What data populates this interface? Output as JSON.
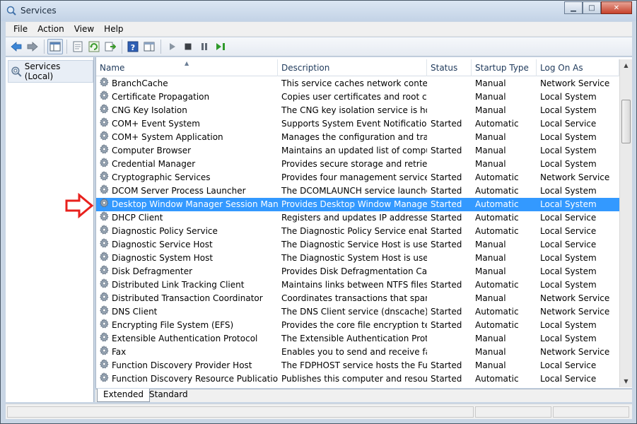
{
  "window": {
    "title": "Services",
    "minimize": "▁",
    "maximize": "□",
    "close": "✕"
  },
  "menu": {
    "file": "File",
    "action": "Action",
    "view": "View",
    "help": "Help"
  },
  "tree": {
    "root_label": "Services (Local)"
  },
  "columns": {
    "name": "Name",
    "description": "Description",
    "status": "Status",
    "startup": "Startup Type",
    "logon": "Log On As"
  },
  "services": [
    {
      "name": "BranchCache",
      "description": "This service caches network content...",
      "status": "",
      "startup": "Manual",
      "logon": "Network Service"
    },
    {
      "name": "Certificate Propagation",
      "description": "Copies user certificates and root cer...",
      "status": "",
      "startup": "Manual",
      "logon": "Local System"
    },
    {
      "name": "CNG Key Isolation",
      "description": "The CNG key isolation service is hos...",
      "status": "",
      "startup": "Manual",
      "logon": "Local System"
    },
    {
      "name": "COM+ Event System",
      "description": "Supports System Event Notification ...",
      "status": "Started",
      "startup": "Automatic",
      "logon": "Local Service"
    },
    {
      "name": "COM+ System Application",
      "description": "Manages the configuration and trac...",
      "status": "",
      "startup": "Manual",
      "logon": "Local System"
    },
    {
      "name": "Computer Browser",
      "description": "Maintains an updated list of compu...",
      "status": "Started",
      "startup": "Manual",
      "logon": "Local System"
    },
    {
      "name": "Credential Manager",
      "description": "Provides secure storage and retrieva...",
      "status": "",
      "startup": "Manual",
      "logon": "Local System"
    },
    {
      "name": "Cryptographic Services",
      "description": "Provides four management services:...",
      "status": "Started",
      "startup": "Automatic",
      "logon": "Network Service"
    },
    {
      "name": "DCOM Server Process Launcher",
      "description": "The DCOMLAUNCH service launche...",
      "status": "Started",
      "startup": "Automatic",
      "logon": "Local System"
    },
    {
      "name": "Desktop Window Manager Session Manager",
      "description": "Provides Desktop Window Manager ...",
      "status": "Started",
      "startup": "Automatic",
      "logon": "Local System"
    },
    {
      "name": "DHCP Client",
      "description": "Registers and updates IP addresses a...",
      "status": "Started",
      "startup": "Automatic",
      "logon": "Local Service"
    },
    {
      "name": "Diagnostic Policy Service",
      "description": "The Diagnostic Policy Service enabl...",
      "status": "Started",
      "startup": "Automatic",
      "logon": "Local Service"
    },
    {
      "name": "Diagnostic Service Host",
      "description": "The Diagnostic Service Host is used ...",
      "status": "Started",
      "startup": "Manual",
      "logon": "Local Service"
    },
    {
      "name": "Diagnostic System Host",
      "description": "The Diagnostic System Host is used ...",
      "status": "",
      "startup": "Manual",
      "logon": "Local System"
    },
    {
      "name": "Disk Defragmenter",
      "description": "Provides Disk Defragmentation Cap...",
      "status": "",
      "startup": "Manual",
      "logon": "Local System"
    },
    {
      "name": "Distributed Link Tracking Client",
      "description": "Maintains links between NTFS files ...",
      "status": "Started",
      "startup": "Automatic",
      "logon": "Local System"
    },
    {
      "name": "Distributed Transaction Coordinator",
      "description": "Coordinates transactions that span ...",
      "status": "",
      "startup": "Manual",
      "logon": "Network Service"
    },
    {
      "name": "DNS Client",
      "description": "The DNS Client service (dnscache) c...",
      "status": "Started",
      "startup": "Automatic",
      "logon": "Network Service"
    },
    {
      "name": "Encrypting File System (EFS)",
      "description": "Provides the core file encryption tec...",
      "status": "Started",
      "startup": "Automatic",
      "logon": "Local System"
    },
    {
      "name": "Extensible Authentication Protocol",
      "description": "The Extensible Authentication Proto...",
      "status": "",
      "startup": "Manual",
      "logon": "Local System"
    },
    {
      "name": "Fax",
      "description": "Enables you to send and receive fax...",
      "status": "",
      "startup": "Manual",
      "logon": "Network Service"
    },
    {
      "name": "Function Discovery Provider Host",
      "description": "The FDPHOST service hosts the Fun...",
      "status": "Started",
      "startup": "Manual",
      "logon": "Local Service"
    },
    {
      "name": "Function Discovery Resource Publication",
      "description": "Publishes this computer and resour...",
      "status": "Started",
      "startup": "Automatic",
      "logon": "Local Service"
    }
  ],
  "selected_service": "Desktop Window Manager Session Manager",
  "tabs": {
    "extended": "Extended",
    "standard": "Standard"
  },
  "colors": {
    "selection": "#3399ff",
    "annotation_arrow": "#e8211d"
  }
}
